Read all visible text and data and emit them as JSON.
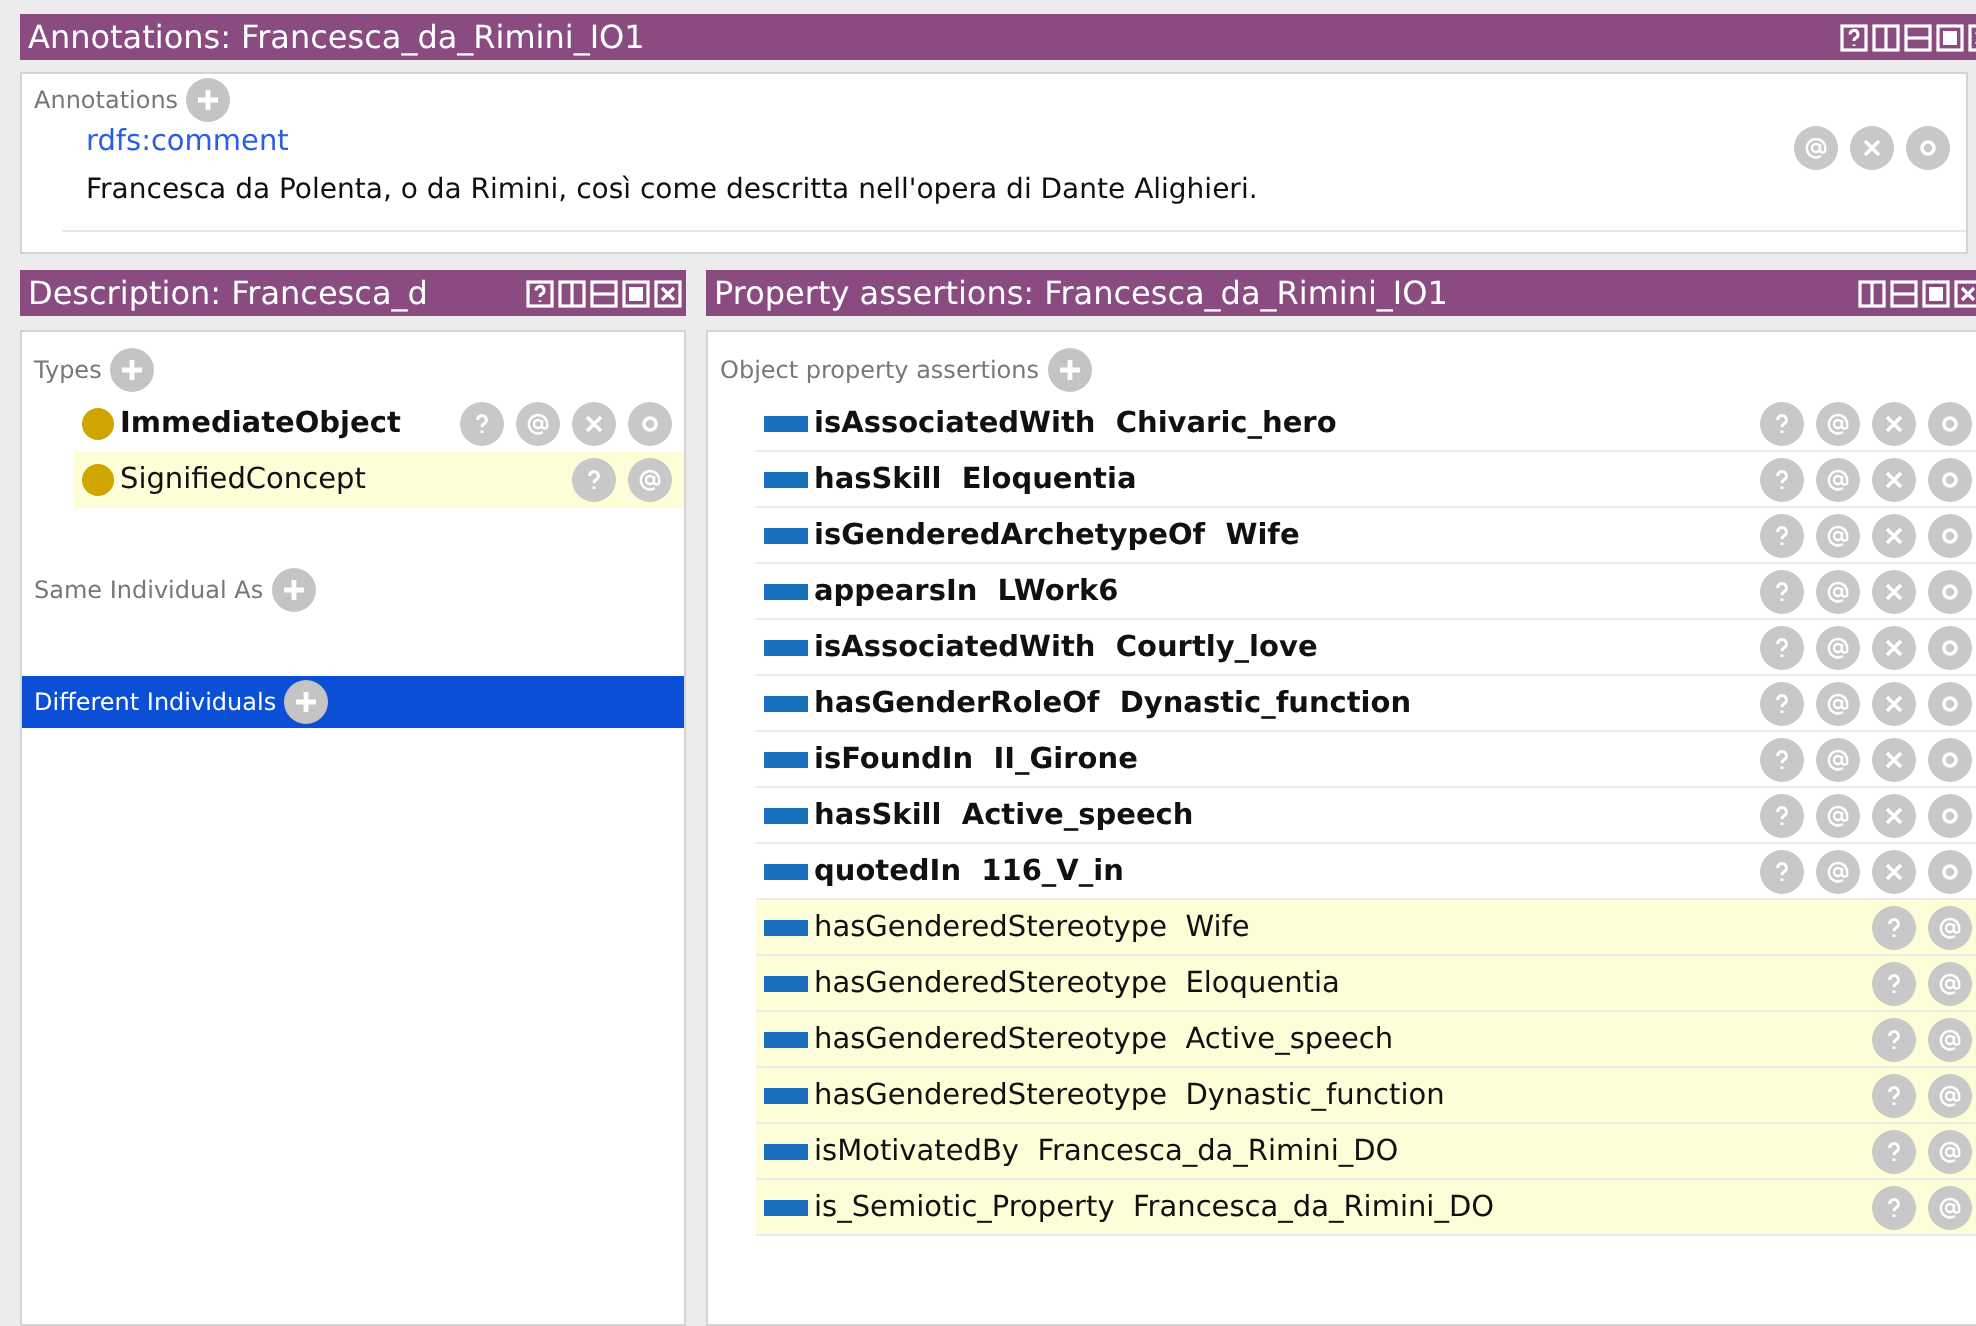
{
  "annotations_view": {
    "title": "Annotations: Francesca_da_Rimini_IO1",
    "controls": [
      {
        "kind": "help"
      },
      {
        "kind": "split_v"
      },
      {
        "kind": "split_h"
      },
      {
        "kind": "maximize"
      },
      {
        "kind": "close"
      }
    ],
    "section_label": "Annotations",
    "items": [
      {
        "property": "rdfs:comment",
        "value": "Francesca da Polenta, o da Rimini, così come descritta nell'opera di Dante Alighieri."
      }
    ]
  },
  "description_view": {
    "title": "Description: Francesca_d",
    "controls": [
      {
        "kind": "help"
      },
      {
        "kind": "split_v"
      },
      {
        "kind": "split_h"
      },
      {
        "kind": "maximize"
      },
      {
        "kind": "close"
      }
    ],
    "sections": [
      {
        "label": "Types",
        "selected": false,
        "items": [
          {
            "text": "ImmediateObject",
            "inferred": false
          },
          {
            "text": "SignifiedConcept",
            "inferred": true
          }
        ]
      },
      {
        "label": "Same Individual As",
        "selected": false
      },
      {
        "label": "Different Individuals",
        "selected": true
      }
    ]
  },
  "property_view": {
    "title": "Property assertions: Francesca_da_Rimini_IO1",
    "controls": [
      {
        "kind": "split_v"
      },
      {
        "kind": "split_h"
      },
      {
        "kind": "maximize"
      },
      {
        "kind": "close"
      }
    ],
    "section_label": "Object property assertions",
    "items": [
      {
        "property": "isAssociatedWith",
        "value": "Chivaric_hero",
        "inferred": false
      },
      {
        "property": "hasSkill",
        "value": "Eloquentia",
        "inferred": false
      },
      {
        "property": "isGenderedArchetypeOf",
        "value": "Wife",
        "inferred": false
      },
      {
        "property": "appearsIn",
        "value": "LWork6",
        "inferred": false
      },
      {
        "property": "isAssociatedWith",
        "value": "Courtly_love",
        "inferred": false
      },
      {
        "property": "hasGenderRoleOf",
        "value": "Dynastic_function",
        "inferred": false
      },
      {
        "property": "isFoundIn",
        "value": "II_Girone",
        "inferred": false
      },
      {
        "property": "hasSkill",
        "value": "Active_speech",
        "inferred": false
      },
      {
        "property": "quotedIn",
        "value": "116_V_in",
        "inferred": false
      },
      {
        "property": "hasGenderedStereotype",
        "value": "Wife",
        "inferred": true
      },
      {
        "property": "hasGenderedStereotype",
        "value": "Eloquentia",
        "inferred": true
      },
      {
        "property": "hasGenderedStereotype",
        "value": "Active_speech",
        "inferred": true
      },
      {
        "property": "hasGenderedStereotype",
        "value": "Dynastic_function",
        "inferred": true
      },
      {
        "property": "isMotivatedBy",
        "value": "Francesca_da_Rimini_DO",
        "inferred": true
      },
      {
        "property": "is_Semiotic_Property",
        "value": "Francesca_da_Rimini_DO",
        "inferred": true
      }
    ]
  }
}
